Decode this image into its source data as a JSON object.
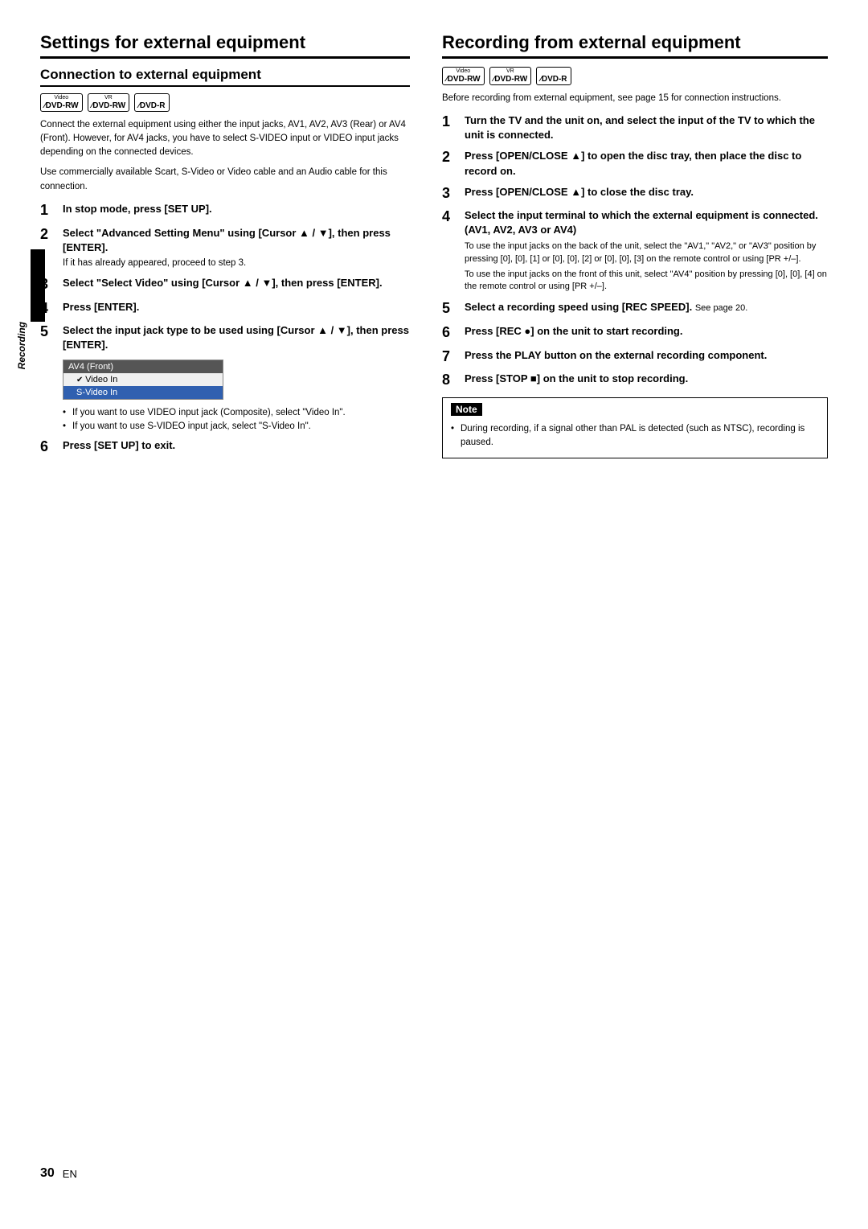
{
  "page": {
    "side_label": "Recording",
    "page_number": "30",
    "en_label": "EN"
  },
  "left": {
    "section_title": "Settings for external equipment",
    "subsection_title": "Connection to external equipment",
    "dvd_badges": [
      {
        "top": "Video",
        "main": "DVD-RW",
        "slash": true
      },
      {
        "top": "VR",
        "main": "DVD-RW",
        "slash": true
      },
      {
        "top": "",
        "main": "DVD-R",
        "slash": true
      }
    ],
    "intro_text_1": "Connect the external equipment using either the input jacks, AV1, AV2, AV3 (Rear) or AV4 (Front). However, for AV4 jacks, you have to select S-VIDEO input or VIDEO input jacks depending on the connected devices.",
    "intro_text_2": "Use commercially available Scart, S-Video or Video cable and an Audio cable for this connection.",
    "steps": [
      {
        "num": "1",
        "main": "In stop mode, press [SET UP].",
        "sub": ""
      },
      {
        "num": "2",
        "main": "Select \"Advanced Setting Menu\" using [Cursor ▲ / ▼], then press [ENTER].",
        "sub": "If it has already appeared, proceed to step 3."
      },
      {
        "num": "3",
        "main": "Select \"Select Video\" using [Cursor ▲ / ▼], then press [ENTER].",
        "sub": ""
      },
      {
        "num": "4",
        "main": "Press [ENTER].",
        "sub": ""
      },
      {
        "num": "5",
        "main": "Select the input jack type to be used using [Cursor ▲ / ▼], then press [ENTER].",
        "sub": ""
      }
    ],
    "menu": {
      "title": "AV4 (Front)",
      "items": [
        {
          "label": "Video In",
          "selected": false,
          "check": true
        },
        {
          "label": "S-Video In",
          "selected": true,
          "check": false
        }
      ]
    },
    "bullets": [
      "If you want to use VIDEO input jack (Composite), select \"Video In\".",
      "If you want to use S-VIDEO input jack, select \"S-Video In\"."
    ],
    "step6": {
      "num": "6",
      "main": "Press [SET UP] to exit."
    }
  },
  "right": {
    "section_title": "Recording from external equipment",
    "dvd_badges": [
      {
        "top": "Video",
        "main": "DVD-RW",
        "slash": true
      },
      {
        "top": "VR",
        "main": "DVD-RW",
        "slash": true
      },
      {
        "top": "",
        "main": "DVD-R",
        "slash": true
      }
    ],
    "intro_text": "Before recording from external equipment, see page 15 for connection instructions.",
    "steps": [
      {
        "num": "1",
        "main": "Turn the TV and the unit on, and select the input of the TV to which the unit is connected.",
        "sub": ""
      },
      {
        "num": "2",
        "main": "Press [OPEN/CLOSE ▲] to open the disc tray, then place the disc to record on.",
        "sub": ""
      },
      {
        "num": "3",
        "main": "Press [OPEN/CLOSE ▲] to close the disc tray.",
        "sub": ""
      },
      {
        "num": "4",
        "main": "Select the input terminal to which the external equipment is connected. (AV1, AV2, AV3 or AV4)",
        "sub_parts": [
          "To use the input jacks on the back of the unit, select the \"AV1,\" \"AV2,\" or \"AV3\" position by pressing [0], [0], [1] or [0], [0], [2] or [0], [0], [3] on the remote control or using [PR +/–].",
          "To use the input jacks on the front of this unit, select \"AV4\" position by pressing [0], [0], [4] on the remote control or using [PR +/–]."
        ]
      },
      {
        "num": "5",
        "main": "Select a recording speed using [REC SPEED].",
        "sub": "See page 20."
      },
      {
        "num": "6",
        "main": "Press [REC ●] on the unit to start recording.",
        "sub": ""
      },
      {
        "num": "7",
        "main": "Press the PLAY button on the external recording component.",
        "sub": ""
      },
      {
        "num": "8",
        "main": "Press [STOP ■] on the unit to stop recording.",
        "sub": ""
      }
    ],
    "note": {
      "title": "Note",
      "bullet": "During recording, if a signal other than PAL is detected (such as NTSC), recording is paused."
    }
  }
}
